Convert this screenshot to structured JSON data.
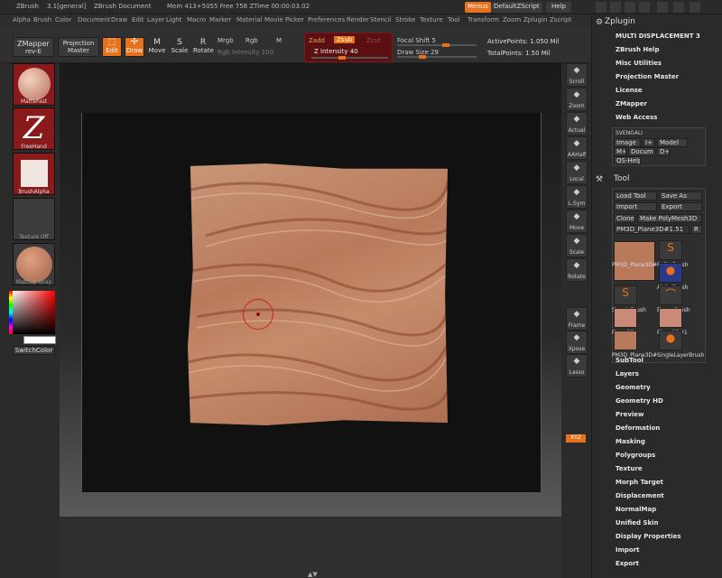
{
  "titlebar": {
    "app": "ZBrush",
    "version": "3.1[general]",
    "document": "ZBrush Document",
    "mem": "Mem 413+5055 Free 758 ZTime 00:00:03.02",
    "menus": "Menus",
    "script": "DefaultZScript",
    "help": "Help"
  },
  "menubar": [
    "Alpha",
    "Brush",
    "Color",
    "Document",
    "Draw",
    "Edit",
    "Layer",
    "Light",
    "Macro",
    "Marker",
    "Material",
    "Movie",
    "Picker",
    "Preferences",
    "Render",
    "Stencil",
    "Stroke",
    "Texture",
    "Tool",
    "Transform",
    "Zoom",
    "Zplugin",
    "Zscript"
  ],
  "toolbar": {
    "zmapper": "ZMapper",
    "zmapper_rev": "rev-E",
    "projection": "Projection",
    "projection2": "Master",
    "edit": "Edit",
    "draw": "Draw",
    "move": "Move",
    "scale": "Scale",
    "rotate": "Rotate",
    "mrgb": "Mrgb",
    "rgb": "Rgb",
    "m": "M",
    "rgb_intensity": "Rgb Intensity 100",
    "zadd": "Zadd",
    "zsub": "Zsub",
    "zcut": "Zcut",
    "z_intensity": "Z Intensity 40",
    "z_intensity_value": 0.4,
    "focal_shift": "Focal Shift 5",
    "draw_size": "Draw Size 29",
    "active_points": "ActivePoints: 1.050 Mil",
    "total_points": "TotalPoints: 1.50 Mil"
  },
  "leftshelf": {
    "material": "MatteFast",
    "stroke": "FreeHand",
    "alpha": "BrushAlpha",
    "texture": "Texture Off",
    "matcap": "MatCap Gray",
    "switch_color": "SwitchColor"
  },
  "rightshelf": [
    "Scroll",
    "Zoom",
    "Actual",
    "AAHalf",
    "Local",
    "L.Sym",
    "Move",
    "Scale",
    "Rotate",
    "XYZ",
    "Frame",
    "Xpose",
    "Lasso"
  ],
  "zplugin": {
    "title": "Zplugin",
    "items": [
      "MULTI DISPLACEMENT 3",
      "ZBrush Help",
      "Misc Utilities",
      "Projection Master",
      "License",
      "ZMapper",
      "Web Access"
    ],
    "svengali": "SVENGALI",
    "image": "Image",
    "i_plus": "I+",
    "model": "Model",
    "m_plus": "M+",
    "docum": "Docum",
    "d_plus": "D+",
    "qs_help": "QS-Help?"
  },
  "tool": {
    "title": "Tool",
    "load": "Load Tool",
    "save": "Save As",
    "import": "Import",
    "export": "Export",
    "clone": "Clone",
    "make_polymesh": "Make PolyMesh3D",
    "current": "PM3D_Plane3D#1.51",
    "r": "R",
    "thumbs": [
      "PM3D_Plane3D#",
      "RollerBrush",
      "AlphaBrush",
      "SimpleBrush",
      "EraserBrush",
      "Plane3D",
      "Plane3D#1",
      "PM3D_Plane3D#",
      "SingleLayerBrush"
    ],
    "subpalettes": [
      "SubTool",
      "Layers",
      "Geometry",
      "Geometry HD",
      "Preview",
      "Deformation",
      "Masking",
      "Polygroups",
      "Texture",
      "Morph Target",
      "Displacement",
      "NormalMap",
      "Unified Skin",
      "Display Properties",
      "Import",
      "Export"
    ]
  },
  "colors": {
    "accent": "#e8711c",
    "panel": "#2a2a2a",
    "clay": "#c08466"
  }
}
